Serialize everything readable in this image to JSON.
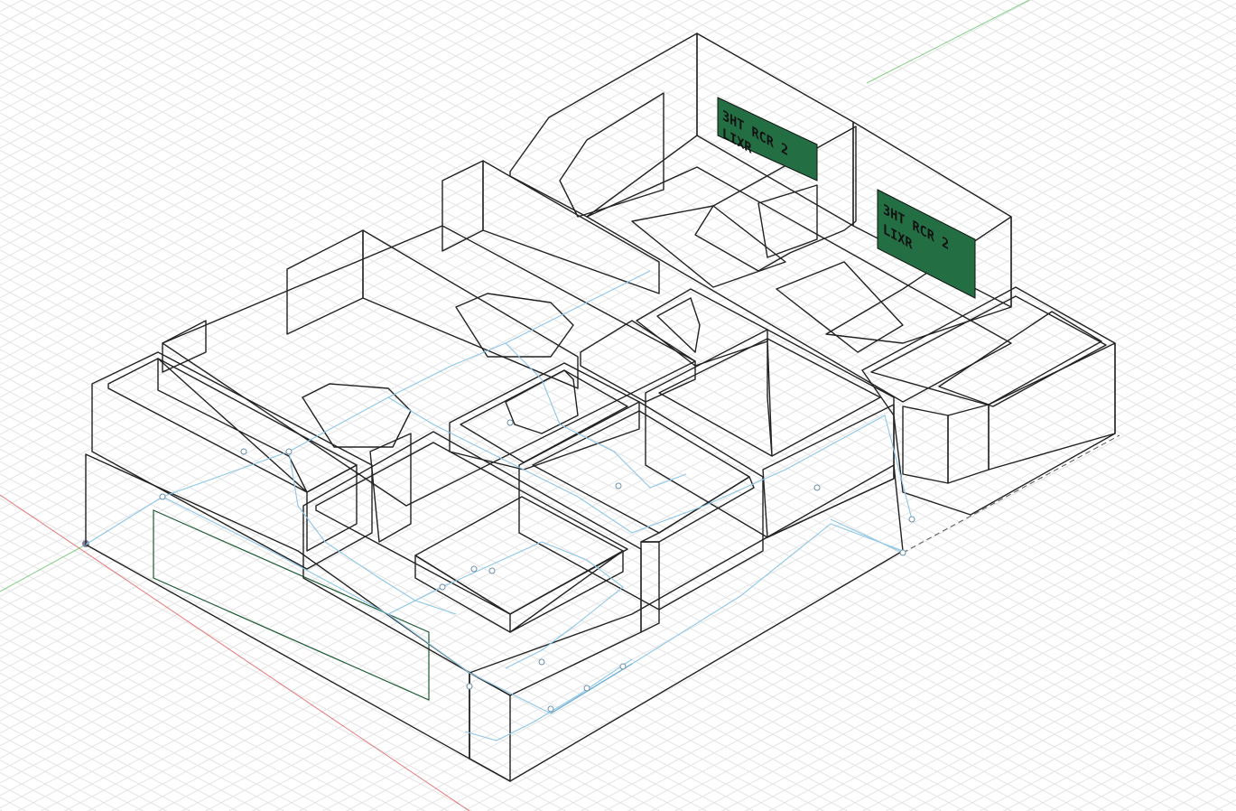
{
  "viewport": {
    "kind": "cad-3d-viewport",
    "background": "#ffffff",
    "grid_color": "#e4e4e4"
  },
  "axes": {
    "x_color": "#e05a5a",
    "y_color": "#6ac46a"
  },
  "engraving": {
    "line1": "3HT RCR 2",
    "line2": "LIXR"
  },
  "materials": {
    "green_light": "#2f8f58",
    "green_dark": "#2f5a45",
    "walnut": "#8a3a1c",
    "pine": "#c49a5d",
    "oak_tray": "#d3ab6e",
    "red": "#8e2424",
    "white": "#e7e5e0",
    "grey_base": "#d4d2cd"
  }
}
